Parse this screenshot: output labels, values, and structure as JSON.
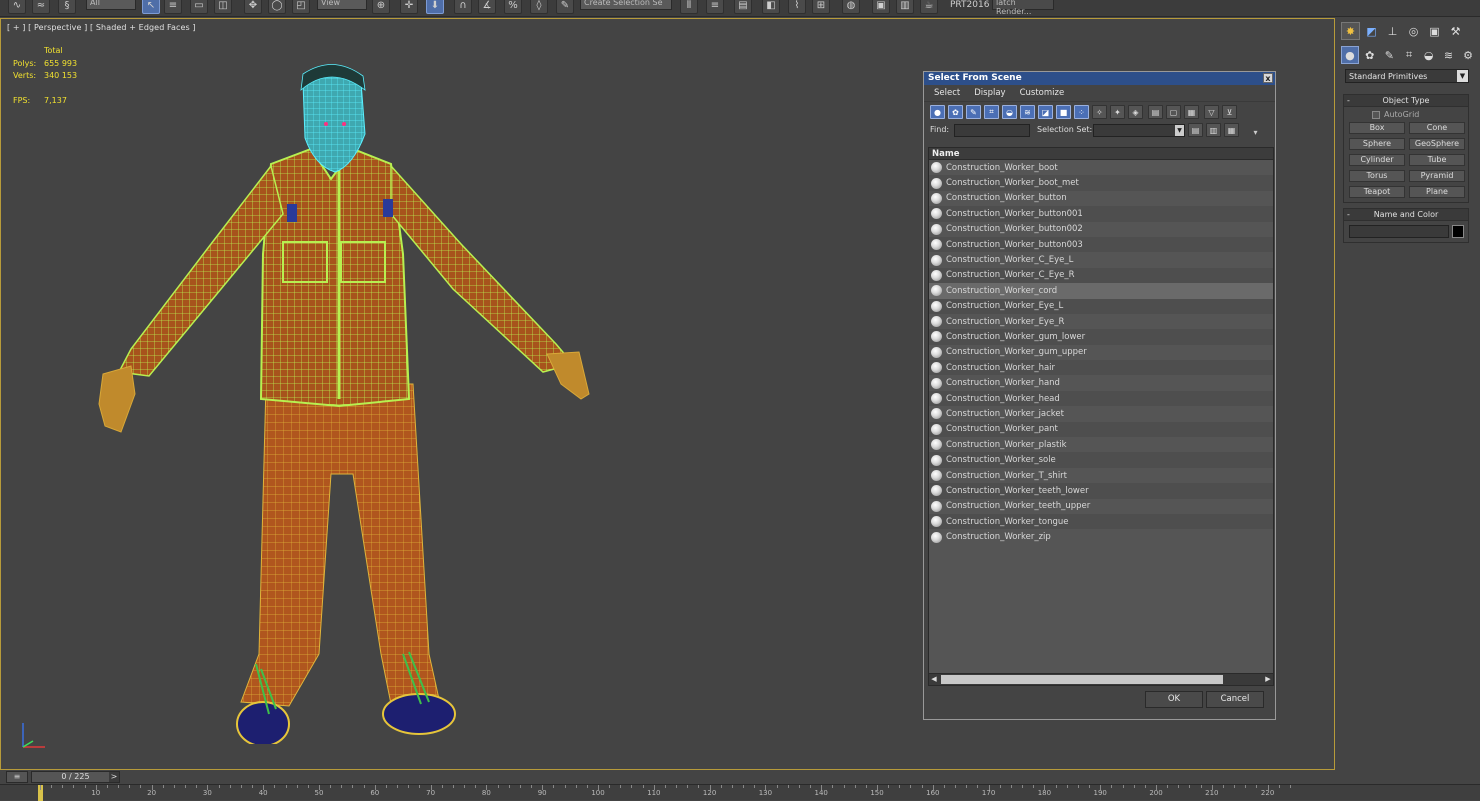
{
  "toolbar": {
    "filter_value": "All",
    "view_value": "View",
    "selection_set_placeholder": "Create Selection Se",
    "prt_label": "PRT2016",
    "batch_render_label": "latch Render..."
  },
  "viewport": {
    "label": "[ + ] [ Perspective ] [ Shaded + Edged Faces ]",
    "stats": {
      "header": "Total",
      "polys_label": "Polys:",
      "polys_value": "655 993",
      "verts_label": "Verts:",
      "verts_value": "340 153",
      "fps_label": "FPS:",
      "fps_value": "7,137"
    }
  },
  "command_panel": {
    "category_value": "Standard Primitives",
    "object_type": {
      "title": "Object Type",
      "autogrid_label": "AutoGrid",
      "buttons": [
        "Box",
        "Cone",
        "Sphere",
        "GeoSphere",
        "Cylinder",
        "Tube",
        "Torus",
        "Pyramid",
        "Teapot",
        "Plane"
      ]
    },
    "name_color": {
      "title": "Name and Color",
      "color": "#000000"
    }
  },
  "dialog": {
    "title": "Select From Scene",
    "close": "x",
    "menu": [
      "Select",
      "Display",
      "Customize"
    ],
    "find_label": "Find:",
    "selection_set_label": "Selection Set:",
    "column_name": "Name",
    "selected_index": 8,
    "items": [
      "Construction_Worker_boot",
      "Construction_Worker_boot_met",
      "Construction_Worker_button",
      "Construction_Worker_button001",
      "Construction_Worker_button002",
      "Construction_Worker_button003",
      "Construction_Worker_C_Eye_L",
      "Construction_Worker_C_Eye_R",
      "Construction_Worker_cord",
      "Construction_Worker_Eye_L",
      "Construction_Worker_Eye_R",
      "Construction_Worker_gum_lower",
      "Construction_Worker_gum_upper",
      "Construction_Worker_hair",
      "Construction_Worker_hand",
      "Construction_Worker_head",
      "Construction_Worker_jacket",
      "Construction_Worker_pant",
      "Construction_Worker_plastik",
      "Construction_Worker_sole",
      "Construction_Worker_T_shirt",
      "Construction_Worker_teeth_lower",
      "Construction_Worker_teeth_upper",
      "Construction_Worker_tongue",
      "Construction_Worker_zip"
    ],
    "ok_label": "OK",
    "cancel_label": "Cancel"
  },
  "timeline": {
    "frame_readout": "0 / 225",
    "ruler_labels": [
      "10",
      "20",
      "30",
      "40",
      "50",
      "60",
      "70",
      "80",
      "90",
      "100",
      "110",
      "120",
      "130",
      "140",
      "150",
      "160",
      "170",
      "180",
      "190",
      "200",
      "210",
      "220"
    ]
  },
  "colors": {
    "accent_blue": "#4f6ea8",
    "viewport_border": "#b79b3a",
    "stats_yellow": "#f0e030",
    "wire_green": "#b8f050",
    "body_orange": "#b0561e"
  }
}
